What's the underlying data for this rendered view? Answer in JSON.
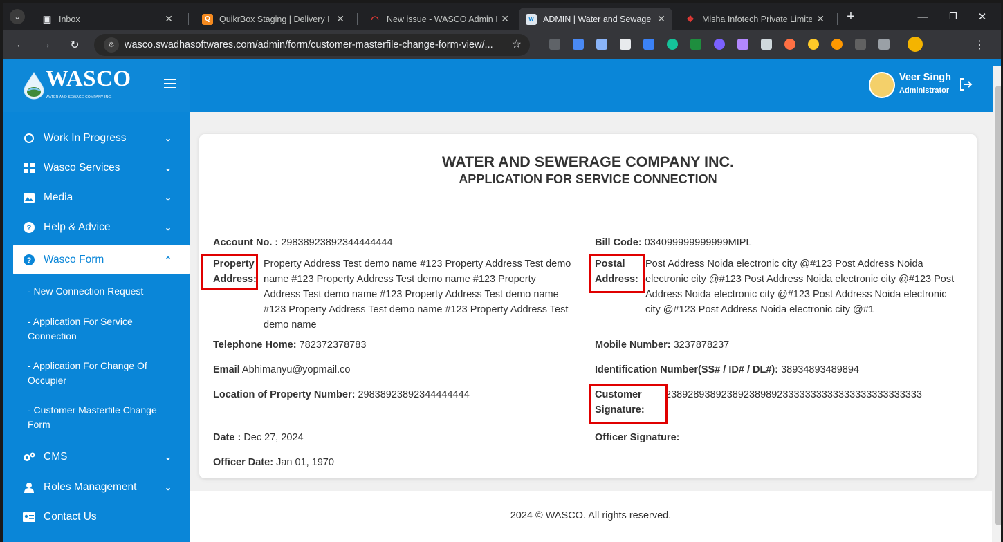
{
  "browser": {
    "tabs": [
      {
        "title": "Inbox",
        "active": false
      },
      {
        "title": "QuikrBox Staging | Delivery I",
        "active": false
      },
      {
        "title": "New issue - WASCO Admin I",
        "active": false
      },
      {
        "title": "ADMIN | Water and Sewage",
        "active": true
      },
      {
        "title": "Misha Infotech Private Limite",
        "active": false
      }
    ],
    "url": "wasco.swadhasoftwares.com/admin/form/customer-masterfile-change-form-view/...",
    "new_tab": "+",
    "close": "✕"
  },
  "sidebar": {
    "logo_text": "WASCO",
    "logo_subtext": "WATER AND SEWAGE COMPANY INC.",
    "items": [
      {
        "label": "Work In Progress",
        "icon": "circle-icon"
      },
      {
        "label": "Wasco Services",
        "icon": "grid-icon"
      },
      {
        "label": "Media",
        "icon": "image-icon"
      },
      {
        "label": "Help & Advice",
        "icon": "question-icon"
      },
      {
        "label": "Wasco Form",
        "icon": "question-icon"
      },
      {
        "label": "CMS",
        "icon": "gears-icon"
      },
      {
        "label": "Roles Management",
        "icon": "user-icon"
      },
      {
        "label": "Contact Us",
        "icon": "id-card-icon"
      }
    ],
    "sub_items": [
      {
        "label": "- New Connection Request"
      },
      {
        "label": "- Application For Service Connection"
      },
      {
        "label": "- Application For Change Of Occupier"
      },
      {
        "label": "- Customer Masterfile Change Form"
      }
    ]
  },
  "header": {
    "user_name": "Veer Singh",
    "user_role": "Administrator"
  },
  "form": {
    "company": "WATER AND SEWERAGE COMPANY INC.",
    "title": "APPLICATION FOR SERVICE CONNECTION",
    "account_label": "Account No. :",
    "account_value": "29838923892344444444",
    "bill_label": "Bill Code:",
    "bill_value": "034099999999999MIPL",
    "property_label_1": "Property",
    "property_label_2": "Address:",
    "property_value": "Property Address Test demo name #123 Property Address Test demo name #123 Property Address Test demo name #123 Property Address Test demo name #123 Property Address Test demo name #123 Property Address Test demo name #123 Property Address Test demo name",
    "postal_label_1": "Postal",
    "postal_label_2": "Address:",
    "postal_value": "Post Address Noida electronic city @#123 Post Address Noida electronic city @#123 Post Address Noida electronic city @#123 Post Address Noida electronic city @#123 Post Address Noida electronic city @#123 Post Address Noida electronic city @#1",
    "telephone_label": "Telephone Home:",
    "telephone_value": "782372378783",
    "mobile_label": "Mobile Number:",
    "mobile_value": "3237878237",
    "email_label": "Email",
    "email_value": "Abhimanyu@yopmail.co",
    "ident_label": "Identification Number(SS# / ID# / DL#):",
    "ident_value": "38934893489894",
    "location_label": "Location of Property Number:",
    "location_value": "29838923892344444444",
    "cust_sig_label_1": "Customer",
    "cust_sig_label_2": "Signature:",
    "cust_sig_value": "2389289389238923898923333333333333333333333333",
    "date_label": "Date :",
    "date_value": "Dec 27, 2024",
    "officer_sig_label": "Officer Signature:",
    "officer_date_label": "Officer Date:",
    "officer_date_value": "Jan 01, 1970"
  },
  "footer": {
    "text": "2024 © WASCO. All rights reserved."
  },
  "colors": {
    "brand_blue": "#0a86d8",
    "highlight_red": "#e00000"
  }
}
